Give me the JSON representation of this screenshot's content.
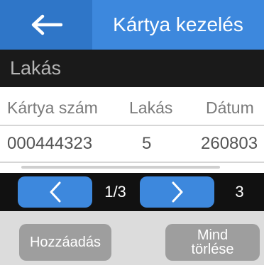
{
  "header": {
    "title": "Kártya kezelés",
    "back_icon": "arrow-left-icon"
  },
  "section": {
    "title": "Lakás"
  },
  "table": {
    "columns": [
      "Kártya szám",
      "Lakás",
      "Dátum"
    ],
    "rows": [
      [
        "000444323",
        "5",
        "260803"
      ]
    ]
  },
  "pager": {
    "prev_icon": "chevron-left-icon",
    "next_icon": "chevron-right-icon",
    "page_indicator": "1/3",
    "count": "3"
  },
  "footer": {
    "add_label": "Hozzáadás",
    "clear_all_line1": "Mind",
    "clear_all_line2": "törlése"
  },
  "colors": {
    "header_blue": "#3d88dd",
    "back_blue": "#2f76c8",
    "section_bg": "#1a1a1a",
    "pager_bg": "#111111",
    "footer_bg": "#dcdcdc",
    "footer_button": "#9e9e9e"
  }
}
